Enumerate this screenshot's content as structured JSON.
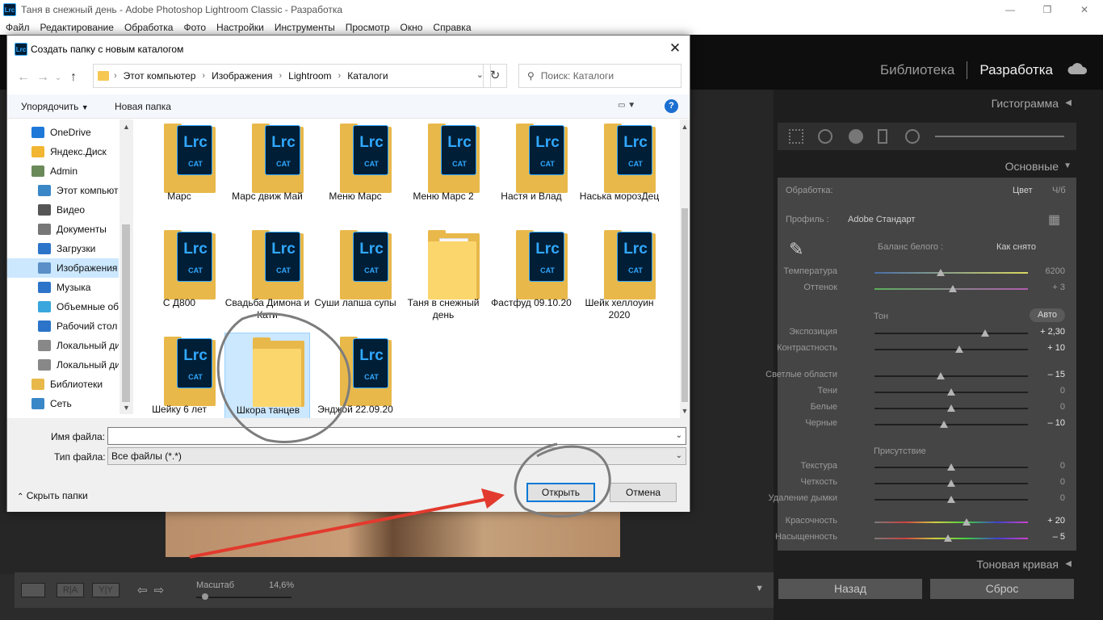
{
  "app": {
    "title": "Таня в снежный день - Adobe Photoshop Lightroom Classic - Разработка",
    "icon_text": "Lrc",
    "menu": [
      "Файл",
      "Редактирование",
      "Обработка",
      "Фото",
      "Настройки",
      "Инструменты",
      "Просмотр",
      "Окно",
      "Справка"
    ],
    "modules": {
      "library": "Библиотека",
      "develop": "Разработка"
    },
    "accent": "#31a8ff"
  },
  "toolbar": {
    "zoom_label": "Масштаб",
    "zoom_value": "14,6%",
    "zoom_level_fraction": 0.1
  },
  "right_panel": {
    "histogram": "Гистограмма",
    "basic": "Основные",
    "treatment_label": "Обработка:",
    "treatment_color": "Цвет",
    "treatment_bw": "Ч/б",
    "profile_label": "Профиль :",
    "profile_value": "Adobe Стандарт",
    "wb_label": "Баланс белого :",
    "wb_value": "Как снято",
    "tone": "Тон",
    "auto": "Авто",
    "presence": "Присутствие",
    "tone_curve": "Тоновая кривая",
    "back_button": "Назад",
    "reset_button": "Сброс",
    "sliders": [
      {
        "label": "Температура",
        "value": "6200",
        "pos": 0.43,
        "active": false
      },
      {
        "label": "Оттенок",
        "value": "+ 3",
        "pos": 0.51,
        "active": false
      },
      {
        "label": "Экспозиция",
        "value": "+ 2,30",
        "pos": 0.72,
        "active": true
      },
      {
        "label": "Контрастность",
        "value": "+ 10",
        "pos": 0.55,
        "active": true
      },
      {
        "label": "Светлые области",
        "value": "– 15",
        "pos": 0.43,
        "active": true
      },
      {
        "label": "Тени",
        "value": "0",
        "pos": 0.5,
        "active": false
      },
      {
        "label": "Белые",
        "value": "0",
        "pos": 0.5,
        "active": false
      },
      {
        "label": "Черные",
        "value": "– 10",
        "pos": 0.45,
        "active": true
      },
      {
        "label": "Текстура",
        "value": "0",
        "pos": 0.5,
        "active": false
      },
      {
        "label": "Четкость",
        "value": "0",
        "pos": 0.5,
        "active": false
      },
      {
        "label": "Удаление дымки",
        "value": "0",
        "pos": 0.5,
        "active": false
      },
      {
        "label": "Красочность",
        "value": "+ 20",
        "pos": 0.6,
        "active": true
      },
      {
        "label": "Насыщенность",
        "value": "– 5",
        "pos": 0.48,
        "active": true
      }
    ]
  },
  "dialog": {
    "title": "Создать папку с новым каталогом",
    "close": "✕",
    "breadcrumb": [
      "Этот компьютер",
      "Изображения",
      "Lightroom",
      "Каталоги"
    ],
    "search_placeholder": "Поиск: Каталоги",
    "organize": "Упорядочить",
    "new_folder": "Новая папка",
    "help": "?",
    "tree": [
      {
        "label": "OneDrive",
        "color": "#1e78d7"
      },
      {
        "label": "Яндекс.Диск",
        "color": "#f2b632"
      },
      {
        "label": "Admin",
        "color": "#6b8a5a"
      },
      {
        "label": "Этот компьютер",
        "color": "#3a87c8"
      },
      {
        "label": "Видео",
        "color": "#555"
      },
      {
        "label": "Документы",
        "color": "#777"
      },
      {
        "label": "Загрузки",
        "color": "#2b74c9"
      },
      {
        "label": "Изображения",
        "color": "#5a8fc7",
        "selected": true
      },
      {
        "label": "Музыка",
        "color": "#2b74c9"
      },
      {
        "label": "Объемные объекты",
        "color": "#39a6dd"
      },
      {
        "label": "Рабочий стол",
        "color": "#2b74c9"
      },
      {
        "label": "Локальный диск (C:)",
        "color": "#888"
      },
      {
        "label": "Локальный диск (D:)",
        "color": "#888"
      },
      {
        "label": "Библиотеки",
        "color": "#e8b84a"
      },
      {
        "label": "Сеть",
        "color": "#3a87c8"
      }
    ],
    "files": [
      {
        "name": "Марс",
        "type": "lrc"
      },
      {
        "name": "Марс движ Май",
        "type": "lrc"
      },
      {
        "name": "Меню Марс",
        "type": "lrc"
      },
      {
        "name": "Меню Марс 2",
        "type": "lrc"
      },
      {
        "name": "Настя и Влад",
        "type": "lrc"
      },
      {
        "name": "Наська морозДец",
        "type": "lrc"
      },
      {
        "name": "С Д800",
        "type": "lrc"
      },
      {
        "name": "Свадьба Димона и Кати",
        "type": "lrc"
      },
      {
        "name": "Суши лапша супы",
        "type": "lrc"
      },
      {
        "name": "Таня в снежный день",
        "type": "paper"
      },
      {
        "name": "Фастфуд 09.10.20",
        "type": "lrc"
      },
      {
        "name": "Шейк хеллоуин 2020",
        "type": "lrc"
      },
      {
        "name": "Шейку 6 лет",
        "type": "lrc"
      },
      {
        "name": "Шкора танцев",
        "type": "empty",
        "selected": true
      },
      {
        "name": "Энджой 22.09.20",
        "type": "lrc"
      }
    ],
    "lrc_text": "Lrc",
    "cat_text": "CAT",
    "filename_label": "Имя файла:",
    "filename_value": "",
    "filetype_label": "Тип файла:",
    "filetype_value": "Все файлы (*.*)",
    "hide_folders": "Скрыть папки",
    "open_button": "Открыть",
    "cancel_button": "Отмена"
  }
}
